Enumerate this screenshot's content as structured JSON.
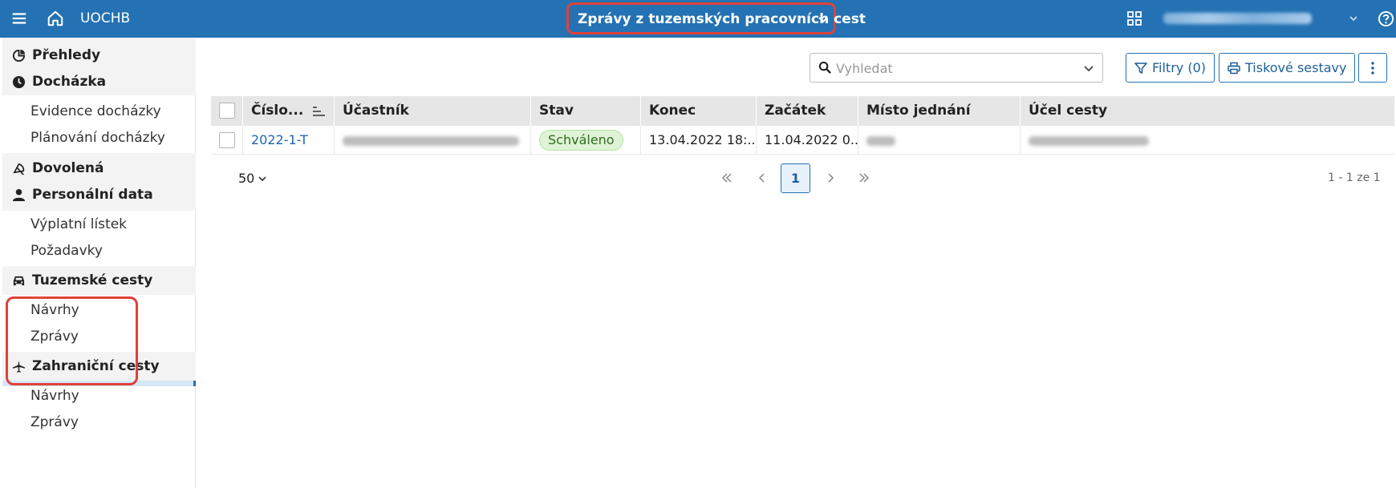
{
  "topbar": {
    "brand": "UOCHB",
    "title": "Zprávy z tuzemských pracovních cest"
  },
  "sidebar": {
    "sections": [
      {
        "label": "Přehledy"
      },
      {
        "label": "Docházka",
        "items": [
          "Evidence docházky",
          "Plánování docházky"
        ]
      },
      {
        "label": "Dovolená"
      },
      {
        "label": "Personální data",
        "items": [
          "Výplatní lístek",
          "Požadavky"
        ]
      },
      {
        "label": "Tuzemské cesty",
        "items": [
          "Návrhy",
          "Zprávy"
        ]
      },
      {
        "label": "Zahraniční cesty",
        "items": [
          "Návrhy",
          "Zprávy"
        ]
      }
    ],
    "active_item": "Zprávy"
  },
  "toolbar": {
    "search_placeholder": "Vyhledat",
    "filters_label": "Filtry (0)",
    "print_label": "Tiskové sestavy"
  },
  "table": {
    "columns": [
      "Číslo...",
      "Účastník",
      "Stav",
      "Konec",
      "Začátek",
      "Místo jednání",
      "Účel cesty"
    ],
    "rows": [
      {
        "cislo": "2022-1-T",
        "stav": "Schváleno",
        "konec": "13.04.2022 18:...",
        "zacatek": "11.04.2022 0..."
      }
    ]
  },
  "pager": {
    "page_size": "50",
    "current_page": "1",
    "count_text": "1 - 1 ze 1"
  },
  "colors": {
    "primary": "#2472b3",
    "highlight": "#e0413a",
    "badge_bg": "#dff3d6"
  }
}
